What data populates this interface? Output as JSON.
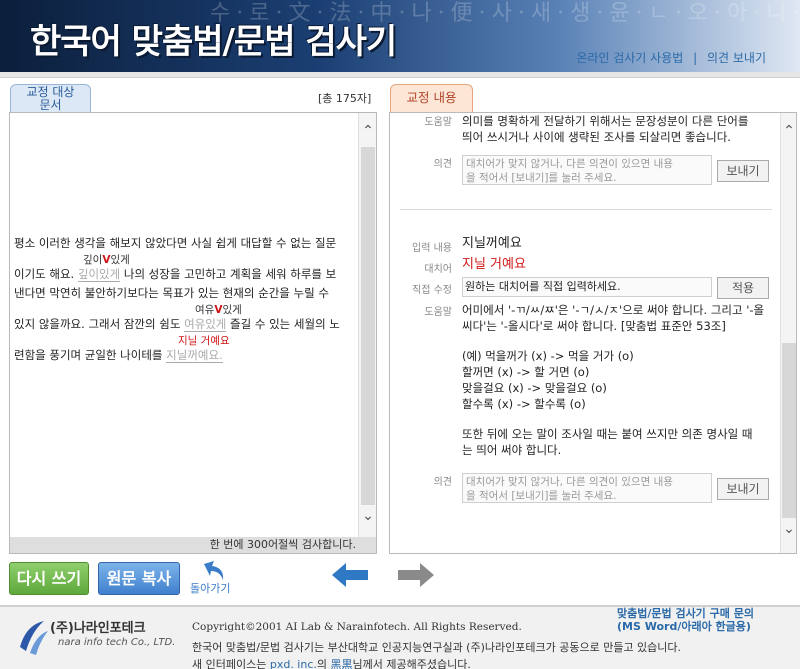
{
  "header": {
    "title": "한국어 맞춤법/문법 검사기",
    "bg_text": "수·로·文·法·中·나·便·사·새·생·윤·ㄴ·오·아·니·이·오",
    "link_usage": "온라인 검사기 사용법",
    "link_sep": "|",
    "link_feedback": "의견 보내기"
  },
  "left": {
    "tab_label_1": "교정 대상",
    "tab_label_2": "문서",
    "char_count": "[총 175자]",
    "lines": {
      "l1": "평소 이러한 생각을 해보지 않았다면 사실 쉽게 대답할 수 없는 질문",
      "l2_a": "이기도 해요. ",
      "l2_err": "깊이있게",
      "l2_b": " 나의 성장을 고민하고 계획을 세워 하루를 보",
      "l3": "낸다면 막연히 불안하기보다는 목표가 있는 현재의 순간을 누릴 수",
      "l4_a": "있지 않을까요. 그래서 잠깐의 쉼도 ",
      "l4_err": "여유있게",
      "l4_b": " 즐길 수 있는 세월의 노",
      "l5_a": "련함을 풍기며 균일한 나이테를 ",
      "l5_err": "지닐꺼예요."
    },
    "sugg1_a": "깊이",
    "sugg1_b": "있게",
    "sugg2_a": "여유",
    "sugg2_b": "있게",
    "sugg3": "지닐 거예요",
    "v_mark": "V",
    "footer": "한 번에 300어절씩 검사합니다."
  },
  "right": {
    "tab_label": "교정 내용",
    "e1": {
      "help_label": "도움말",
      "help_text_1": "의미를 명확하게 전달하기 위해서는 문장성분이 다른 단어를",
      "help_text_2": "띄어 쓰시거나 사이에 생략된 조사를 되살리면 좋습니다.",
      "memo_label": "의견",
      "memo_placeholder_1": "대치어가 맞지 않거나, 다른 의견이 있으면 내용",
      "memo_placeholder_2": "을 적어서 [보내기]를 눌러 주세요.",
      "send_label": "보내기"
    },
    "e2": {
      "input_label": "입력 내용",
      "input_value": "지닐꺼예요",
      "repl_label": "대치어",
      "repl_value": "지닐 거예요",
      "direct_label": "직접 수정",
      "direct_placeholder": "원하는 대치어를 직접 입력하세요.",
      "apply_label": "적용",
      "help_label": "도움말",
      "help_lines": {
        "h1": "어미에서 '-ㄲ/ㅆ/ㅉ'은 '-ㄱ/ㅅ/ㅈ'으로 써야 합니다. 그리고 '-올",
        "h2": "씨다'는 '-올시다'로 써야 합니다. [맞춤법 표준안 53조]",
        "h3": "(예) 먹을꺼가 (x) -> 먹을 거가 (o)",
        "h4": "할꺼면 (x) -> 할 거면 (o)",
        "h5": "맞을걸요 (x) -> 맞을걸요 (o)",
        "h6": "할수록 (x) -> 할수록 (o)",
        "h7": "또한 뒤에 오는 말이 조사일 때는 붙여 쓰지만 의존 명사일 때",
        "h8": "는 띄어 써야 합니다."
      },
      "memo_label": "의견",
      "memo_placeholder_1": "대치어가 맞지 않거나, 다른 의견이 있으면 내용",
      "memo_placeholder_2": "을 적어서 [보내기]를 눌러 주세요.",
      "send_label": "보내기"
    }
  },
  "buttons": {
    "rewrite": "다시 쓰기",
    "copy": "원문 복사",
    "back": "돌아가기"
  },
  "footer": {
    "logo_ko": "(주)나라인포테크",
    "logo_en": "nara info tech Co., LTD.",
    "copyright": "Copyright©2001 AI Lab & Narainfotech. All Rights Reserved.",
    "desc1": "한국어 맞춤법/문법 검사기는 부산대학교 인공지능연구실과 (주)나라인포테크가 공동으로 만들고 있습니다.",
    "desc2_a": "새 인터페이스는 ",
    "desc2_link1": "pxd. inc.",
    "desc2_b": "의 ",
    "desc2_link2": "黑黒",
    "desc2_c": "님께서 제공해주셨습니다.",
    "buy_1": "맞춤법/문법 검사기 구매 문의",
    "buy_2": "(MS Word/아래아 한글용)"
  }
}
